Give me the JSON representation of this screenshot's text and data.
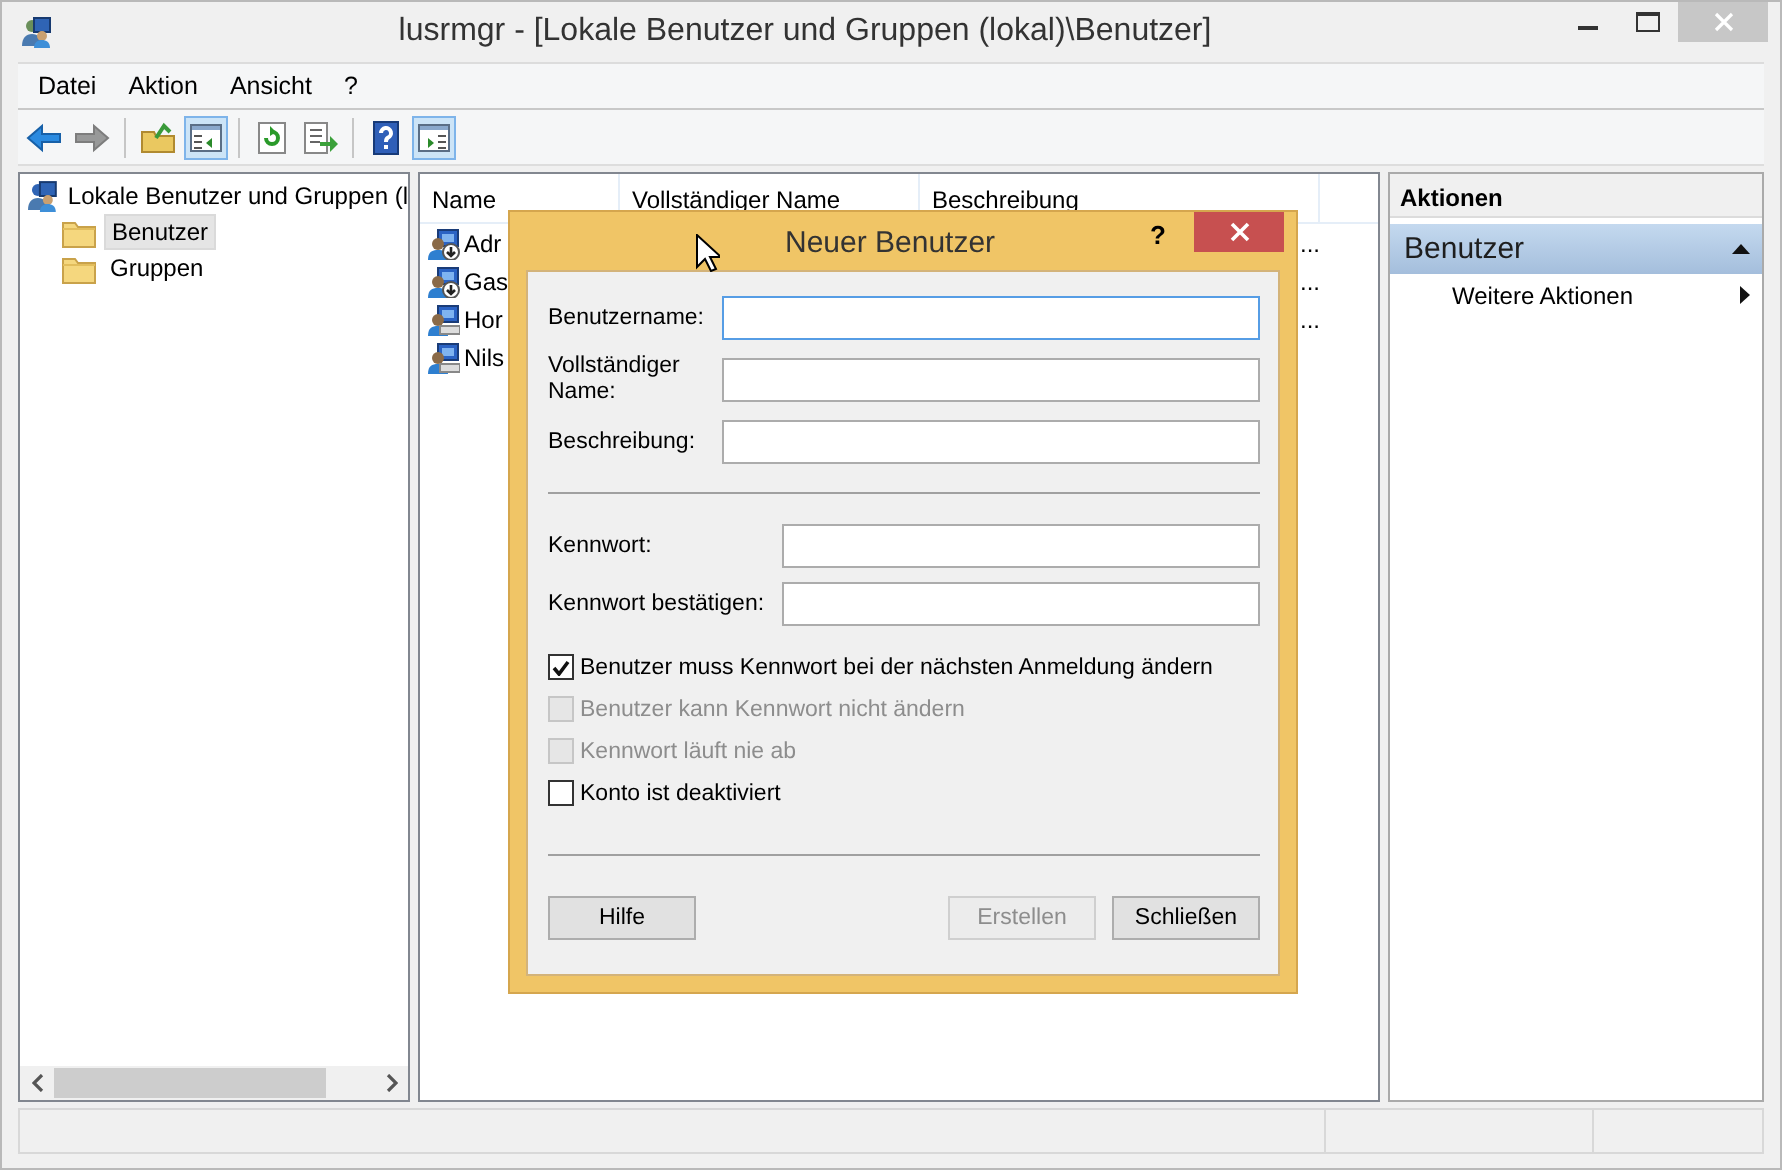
{
  "window": {
    "title": "lusrmgr - [Lokale Benutzer und Gruppen (lokal)\\Benutzer]"
  },
  "menu": [
    {
      "label": "Datei"
    },
    {
      "label": "Aktion"
    },
    {
      "label": "Ansicht"
    },
    {
      "label": "?"
    }
  ],
  "toolbar": [
    {
      "kind": "back",
      "pressed": false,
      "disabled": false
    },
    {
      "kind": "forward",
      "pressed": false,
      "disabled": true
    },
    {
      "kind": "sep"
    },
    {
      "kind": "up",
      "pressed": false,
      "disabled": false
    },
    {
      "kind": "tree",
      "pressed": true,
      "disabled": false
    },
    {
      "kind": "sep"
    },
    {
      "kind": "refresh",
      "pressed": false,
      "disabled": false
    },
    {
      "kind": "export",
      "pressed": false,
      "disabled": false
    },
    {
      "kind": "sep"
    },
    {
      "kind": "help",
      "pressed": false,
      "disabled": false
    },
    {
      "kind": "actionpane",
      "pressed": true,
      "disabled": false
    }
  ],
  "tree": {
    "label": "Lokale Benutzer und Gruppen (l",
    "children": [
      {
        "label": "Benutzer",
        "selected": true
      },
      {
        "label": "Gruppen",
        "selected": false
      }
    ]
  },
  "list": {
    "columns": [
      "Name",
      "Vollständiger Name",
      "Beschreibung"
    ],
    "rows": [
      {
        "name": "Adr",
        "disabled": true,
        "column_3": "..."
      },
      {
        "name": "Gas",
        "disabled": true,
        "column_3": "..."
      },
      {
        "name": "Hor",
        "disabled": false,
        "column_3": "..."
      },
      {
        "name": "Nils",
        "disabled": false
      }
    ]
  },
  "actions": {
    "header": "Aktionen",
    "section": {
      "title": "Benutzer",
      "expanded": true
    },
    "items": [
      {
        "label": "Weitere Aktionen"
      }
    ]
  },
  "dialog": {
    "title": "Neuer Benutzer",
    "help": "?",
    "field_groups": [
      [
        {
          "label": "Benutzername:",
          "focused": true
        },
        {
          "label": "Vollständiger Name:",
          "focused": false
        },
        {
          "label": "Beschreibung:",
          "focused": false
        }
      ],
      [
        {
          "label": "Kennwort:",
          "focused": false
        },
        {
          "label": "Kennwort bestätigen:",
          "focused": false
        }
      ]
    ],
    "checkboxes": [
      {
        "label": "Benutzer muss Kennwort bei der nächsten Anmeldung ändern",
        "checked": true,
        "disabled": false
      },
      {
        "label": "Benutzer kann Kennwort nicht ändern",
        "checked": false,
        "disabled": true
      },
      {
        "label": "Kennwort läuft nie ab",
        "checked": false,
        "disabled": true
      },
      {
        "label": "Konto ist deaktiviert",
        "checked": false,
        "disabled": false
      }
    ],
    "buttons": [
      {
        "label": "Hilfe",
        "disabled": false
      },
      {
        "label": "Erstellen",
        "disabled": true
      },
      {
        "label": "Schließen",
        "disabled": false
      }
    ]
  }
}
